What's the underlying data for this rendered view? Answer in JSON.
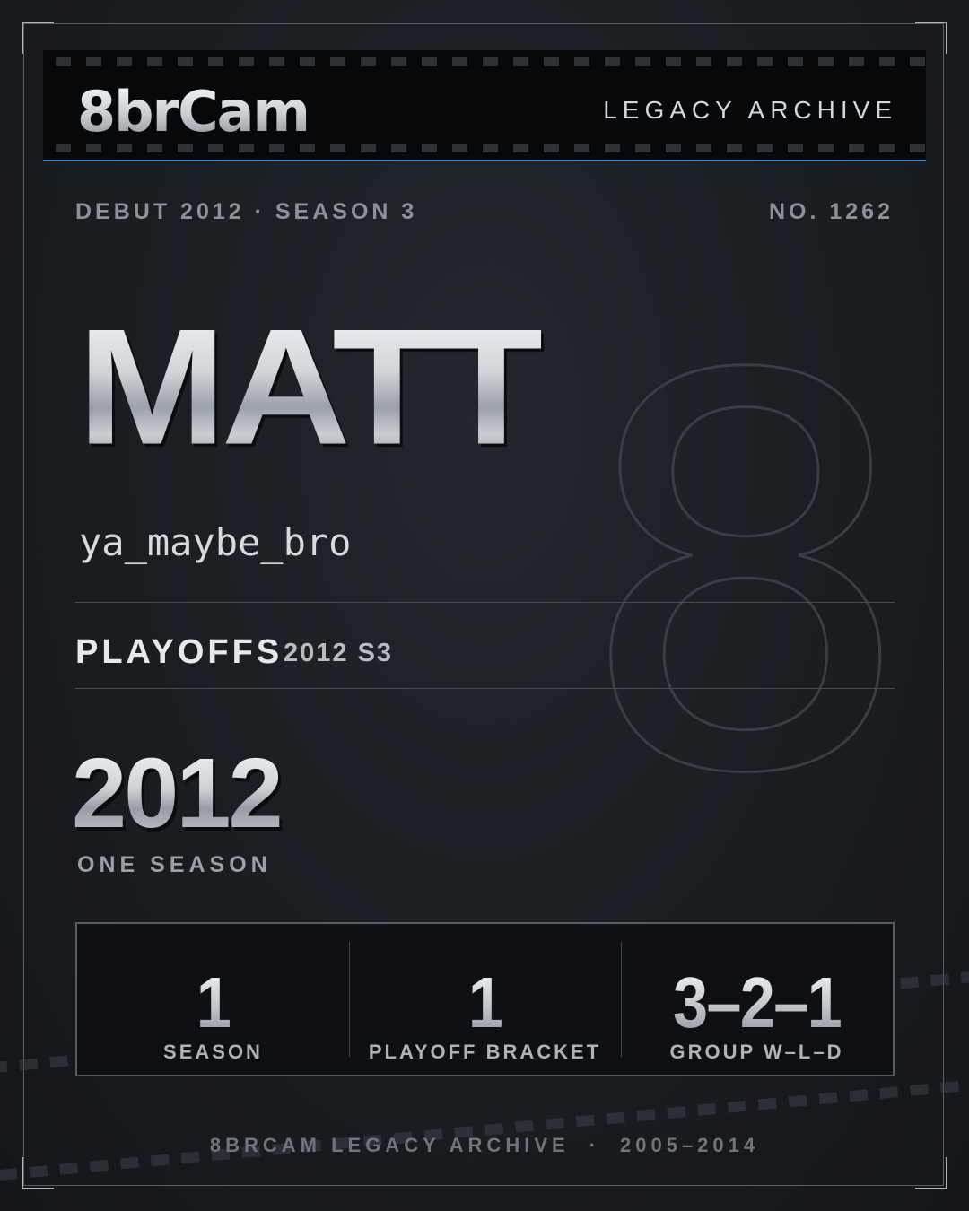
{
  "header": {
    "logo": "8brCam",
    "archive_title": "LEGACY ARCHIVE"
  },
  "meta": {
    "left": "DEBUT 2012 · SEASON 3",
    "right": "NO. 1262"
  },
  "background_number": "8",
  "player": {
    "name": "MATT",
    "handle": "ya_maybe_bro"
  },
  "achievement": {
    "title": "PLAYOFFS",
    "detail": "2012 S3"
  },
  "tenure": {
    "year": "2012",
    "label": "ONE SEASON"
  },
  "stats": [
    {
      "value": "1",
      "label": "SEASON"
    },
    {
      "value": "1",
      "label": "PLAYOFF BRACKET"
    },
    {
      "value": "3–2–1",
      "label": "GROUP W–L–D"
    }
  ],
  "footer": {
    "left": "8BRCAM LEGACY ARCHIVE",
    "separator": "·",
    "right": "2005–2014"
  },
  "colors": {
    "background": "#1a1d22",
    "accent_line": "#3f7fc9",
    "header_bg": "#07080a"
  }
}
